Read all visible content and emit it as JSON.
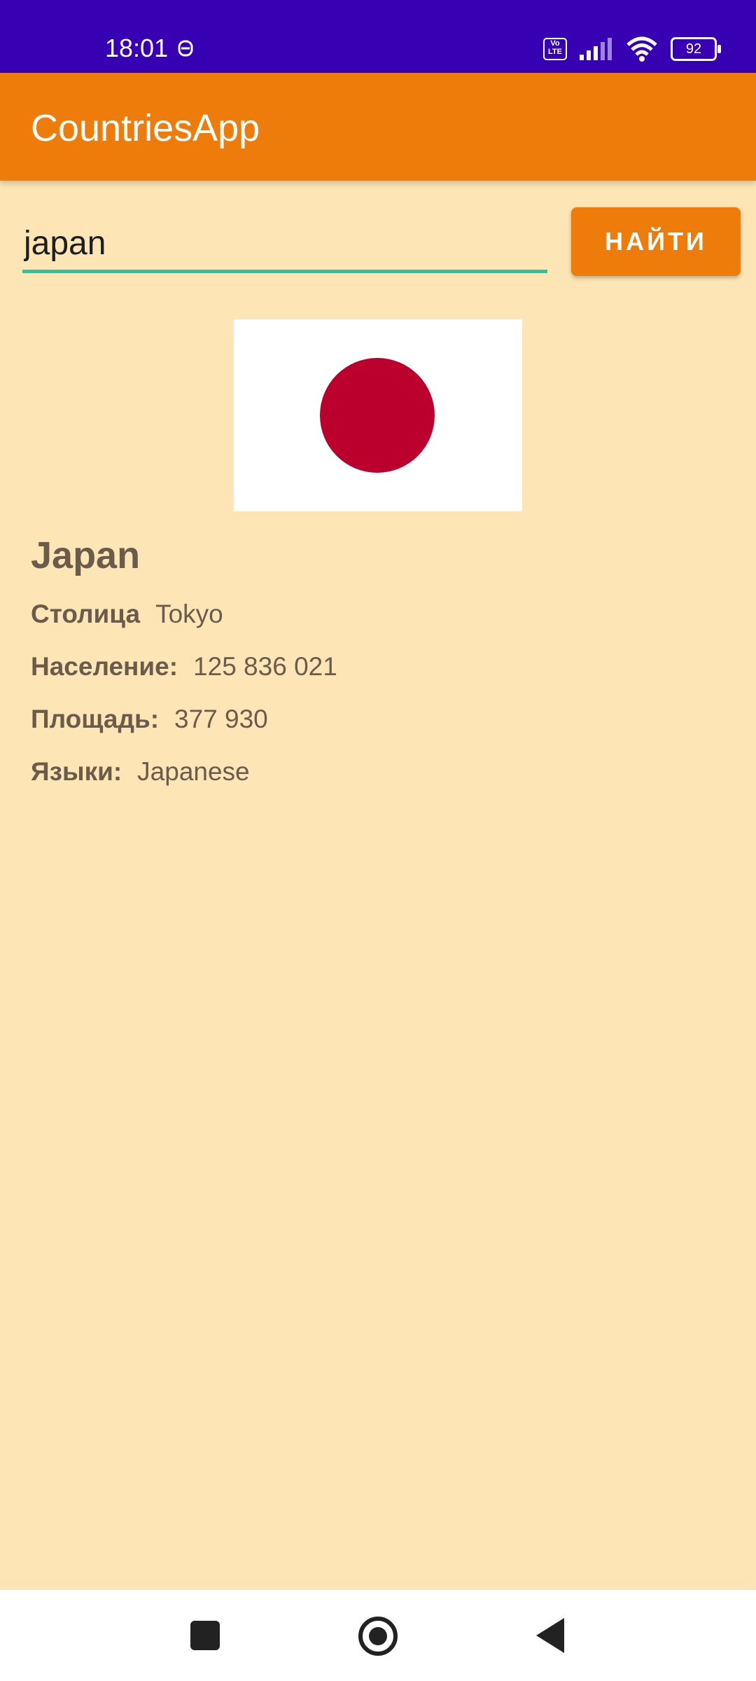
{
  "status_bar": {
    "time": "18:01",
    "icons": [
      "alarm-icon",
      "volte-icon",
      "signal-icon",
      "wifi-icon",
      "battery-icon"
    ],
    "volte_text": "Vo\nLTE",
    "battery_level": "92"
  },
  "app_bar": {
    "title": "CountriesApp",
    "color": "#ed7c0b"
  },
  "search": {
    "value": "japan",
    "button_label": "НАЙТИ",
    "underline_color": "#20c7a8"
  },
  "country": {
    "name": "Japan",
    "flag": "japan-flag",
    "details": [
      {
        "label": "Столица",
        "value": "Tokyo"
      },
      {
        "label": "Население:",
        "value": "125 836 021"
      },
      {
        "label": "Площадь:",
        "value": "377 930"
      },
      {
        "label": "Языки:",
        "value": "Japanese"
      }
    ]
  },
  "navigation": {
    "icons": [
      "recents-square-icon",
      "home-circle-icon",
      "back-triangle-icon"
    ]
  },
  "colors": {
    "status_bar": "#3700b3",
    "background": "#fde5b5",
    "flag_red": "#bc002d",
    "text": "#6b5b4b"
  }
}
